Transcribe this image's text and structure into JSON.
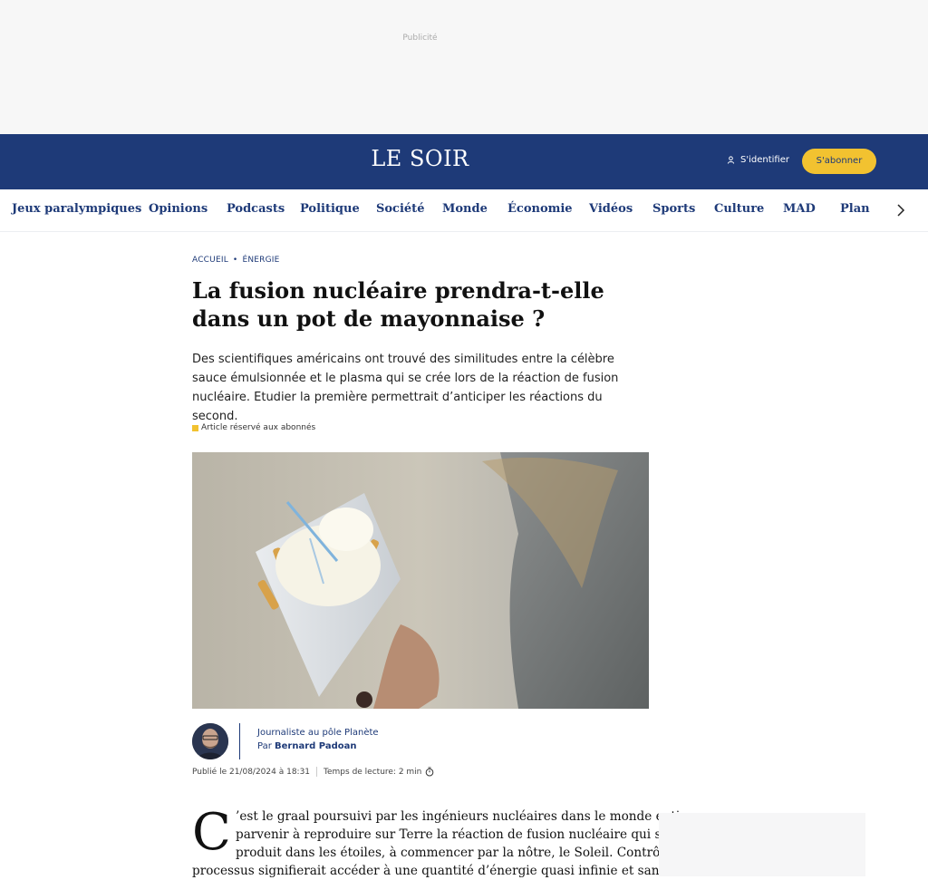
{
  "ad": {
    "label": "Publicité"
  },
  "header": {
    "logo": "LE SOIR",
    "login_label": "S'identifier",
    "subscribe_label": "S'abonner",
    "brand_color": "#1e3a78",
    "accent_color": "#f2c230"
  },
  "nav": {
    "items": [
      "Jeux paralympiques",
      "Opinions",
      "Podcasts",
      "Politique",
      "Société",
      "Monde",
      "Économie",
      "Vidéos",
      "Sports",
      "Culture",
      "MAD",
      "Plan"
    ],
    "more_icon": "chevron-right-icon"
  },
  "article": {
    "breadcrumb": {
      "home": "ACCUEIL",
      "section": "ÉNERGIE"
    },
    "title": "La fusion nucléaire prendra-t-elle dans un pot de mayonnaise ?",
    "lead": "Des scientifiques américains ont trouvé des similitudes entre la célèbre sauce émulsionnée et le plasma qui se crée lors de la réaction de fusion nucléaire. Etudier la première permettrait d’anticiper les réactions du second.",
    "premium_label": "Article réservé aux abonnés",
    "author": {
      "role": "Journaliste au pôle Planète",
      "by_prefix": "Par",
      "name": "Bernard Padoan"
    },
    "published": "Publié le 21/08/2024 à 18:31",
    "reading_time": "Temps de lecture: 2 min",
    "body": {
      "dropcap": "C",
      "lines": [
        "’est le graal poursuivi par les ingénieurs nucléaires dans le monde entier :",
        "parvenir à reproduire sur Terre la réaction de fusion nucléaire qui se",
        "produit dans les étoiles, à commencer par la nôtre, le Soleil. Contrôler ce",
        "processus signifierait accéder à une quantité d’énergie quasi infinie et sans"
      ]
    }
  }
}
